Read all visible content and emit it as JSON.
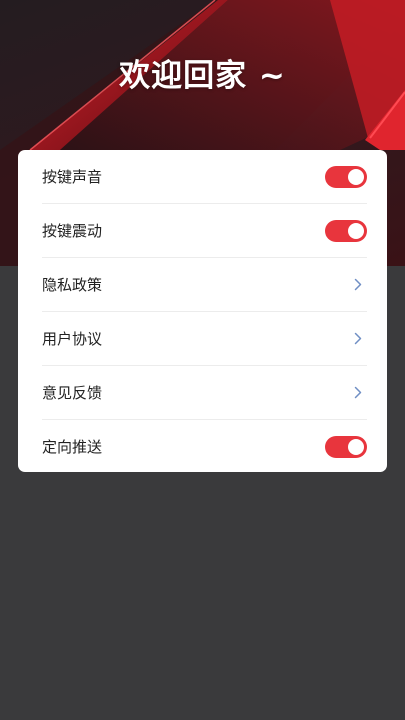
{
  "header": {
    "title": "欢迎回家 ~"
  },
  "settings": {
    "rows": [
      {
        "label": "按键声音",
        "control": "toggle",
        "on": true
      },
      {
        "label": "按键震动",
        "control": "toggle",
        "on": true
      },
      {
        "label": "隐私政策",
        "control": "chevron-right-icon"
      },
      {
        "label": "用户协议",
        "control": "chevron-right-icon"
      },
      {
        "label": "意见反馈",
        "control": "chevron-right-icon"
      },
      {
        "label": "定向推送",
        "control": "toggle",
        "on": true
      }
    ]
  },
  "colors": {
    "accent": "#e8353d",
    "chevron": "#6f8fc4",
    "background": "#3a3a3c"
  }
}
